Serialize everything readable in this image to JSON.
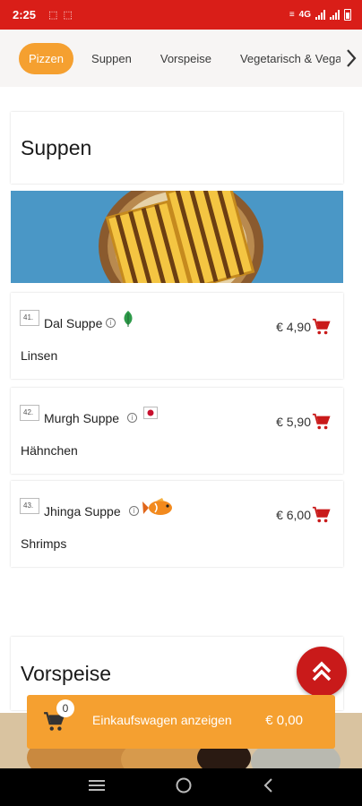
{
  "status_bar": {
    "time": "2:25",
    "network": "4G"
  },
  "categories": [
    {
      "label": "Pizzen",
      "active": true
    },
    {
      "label": "Suppen",
      "active": false
    },
    {
      "label": "Vorspeise",
      "active": false
    },
    {
      "label": "Vegetarisch & Vegan",
      "active": false
    }
  ],
  "sections": [
    {
      "title": "Suppen",
      "items": [
        {
          "number": "41.",
          "name": "Dal Suppe",
          "description": "Linsen",
          "price": "€ 4,90",
          "tag_icon": "leaf-icon"
        },
        {
          "number": "42.",
          "name": "Murgh Suppe",
          "description": "Hähnchen",
          "price": "€ 5,90",
          "tag_icon": "japan-flag-icon"
        },
        {
          "number": "43.",
          "name": "Jhinga Suppe",
          "description": "Shrimps",
          "price": "€ 6,00",
          "tag_icon": "fish-icon"
        }
      ]
    },
    {
      "title": "Vorspeise"
    }
  ],
  "cart": {
    "count": "0",
    "label": "Einkaufswagen anzeigen",
    "total": "€ 0,00"
  },
  "colors": {
    "status_bar": "#d91e18",
    "accent": "#f5a030",
    "cart_red": "#c91a1a"
  }
}
